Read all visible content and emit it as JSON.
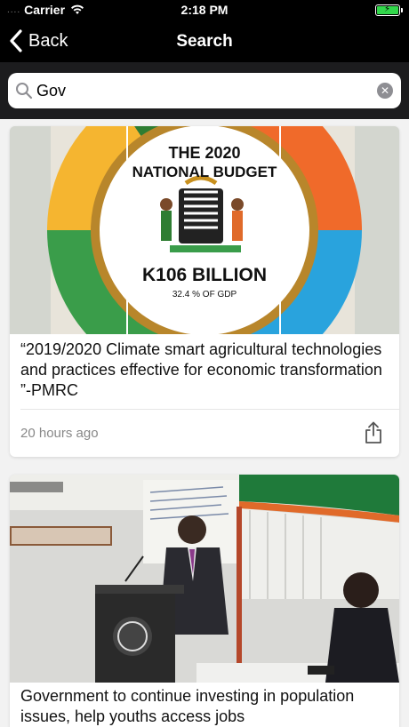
{
  "status_bar": {
    "signal_dots": "....",
    "carrier": "Carrier",
    "time": "2:18 PM"
  },
  "nav": {
    "back_label": "Back",
    "title": "Search"
  },
  "search": {
    "value": "Gov",
    "clear_icon": "clear-icon"
  },
  "articles": [
    {
      "title": "“2019/2020 Climate smart agricultural technologies and practices effective for economic transformation ”-PMRC",
      "time": "20 hours ago",
      "image": {
        "line1": "THE 2020",
        "line2": "NATIONAL BUDGET",
        "line3": "K106 BILLION",
        "line4": "32.4 % OF GDP"
      }
    },
    {
      "title": "Government to continue investing in population issues, help youths access jobs"
    }
  ],
  "colors": {
    "battery": "#32d74b",
    "nav_bg": "#000000",
    "search_bar_bg": "#1c1c1e",
    "content_bg": "#f2f2f2"
  }
}
